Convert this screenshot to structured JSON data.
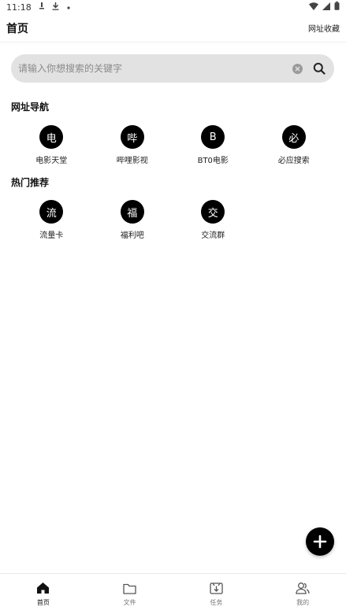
{
  "status_bar": {
    "time": "11:18",
    "icons": [
      "usb-icon",
      "download-icon",
      "dot-icon",
      "wifi-icon",
      "signal-icon",
      "battery-icon"
    ]
  },
  "header": {
    "title": "首页",
    "bookmark_label": "网址收藏"
  },
  "search": {
    "placeholder": "请输入你想搜索的关键字",
    "value": ""
  },
  "nav_section": {
    "title": "网址导航",
    "items": [
      {
        "glyph": "电",
        "label": "电影天堂"
      },
      {
        "glyph": "哔",
        "label": "哔哩影视"
      },
      {
        "glyph": "B",
        "label": "BT0电影"
      },
      {
        "glyph": "必",
        "label": "必应搜索"
      }
    ]
  },
  "hot_section": {
    "title": "热门推荐",
    "items": [
      {
        "glyph": "流",
        "label": "流量卡"
      },
      {
        "glyph": "福",
        "label": "福利吧"
      },
      {
        "glyph": "交",
        "label": "交流群"
      }
    ]
  },
  "fab": {
    "icon": "plus-icon"
  },
  "bottom_nav": {
    "tabs": [
      {
        "label": "首页",
        "icon": "home-icon",
        "active": true
      },
      {
        "label": "文件",
        "icon": "folder-icon",
        "active": false
      },
      {
        "label": "任务",
        "icon": "download-box-icon",
        "active": false
      },
      {
        "label": "我的",
        "icon": "user-icon",
        "active": false
      }
    ]
  },
  "colors": {
    "accent": "#000000",
    "search_bg": "#e2e2e2",
    "inactive_text": "#777777"
  }
}
